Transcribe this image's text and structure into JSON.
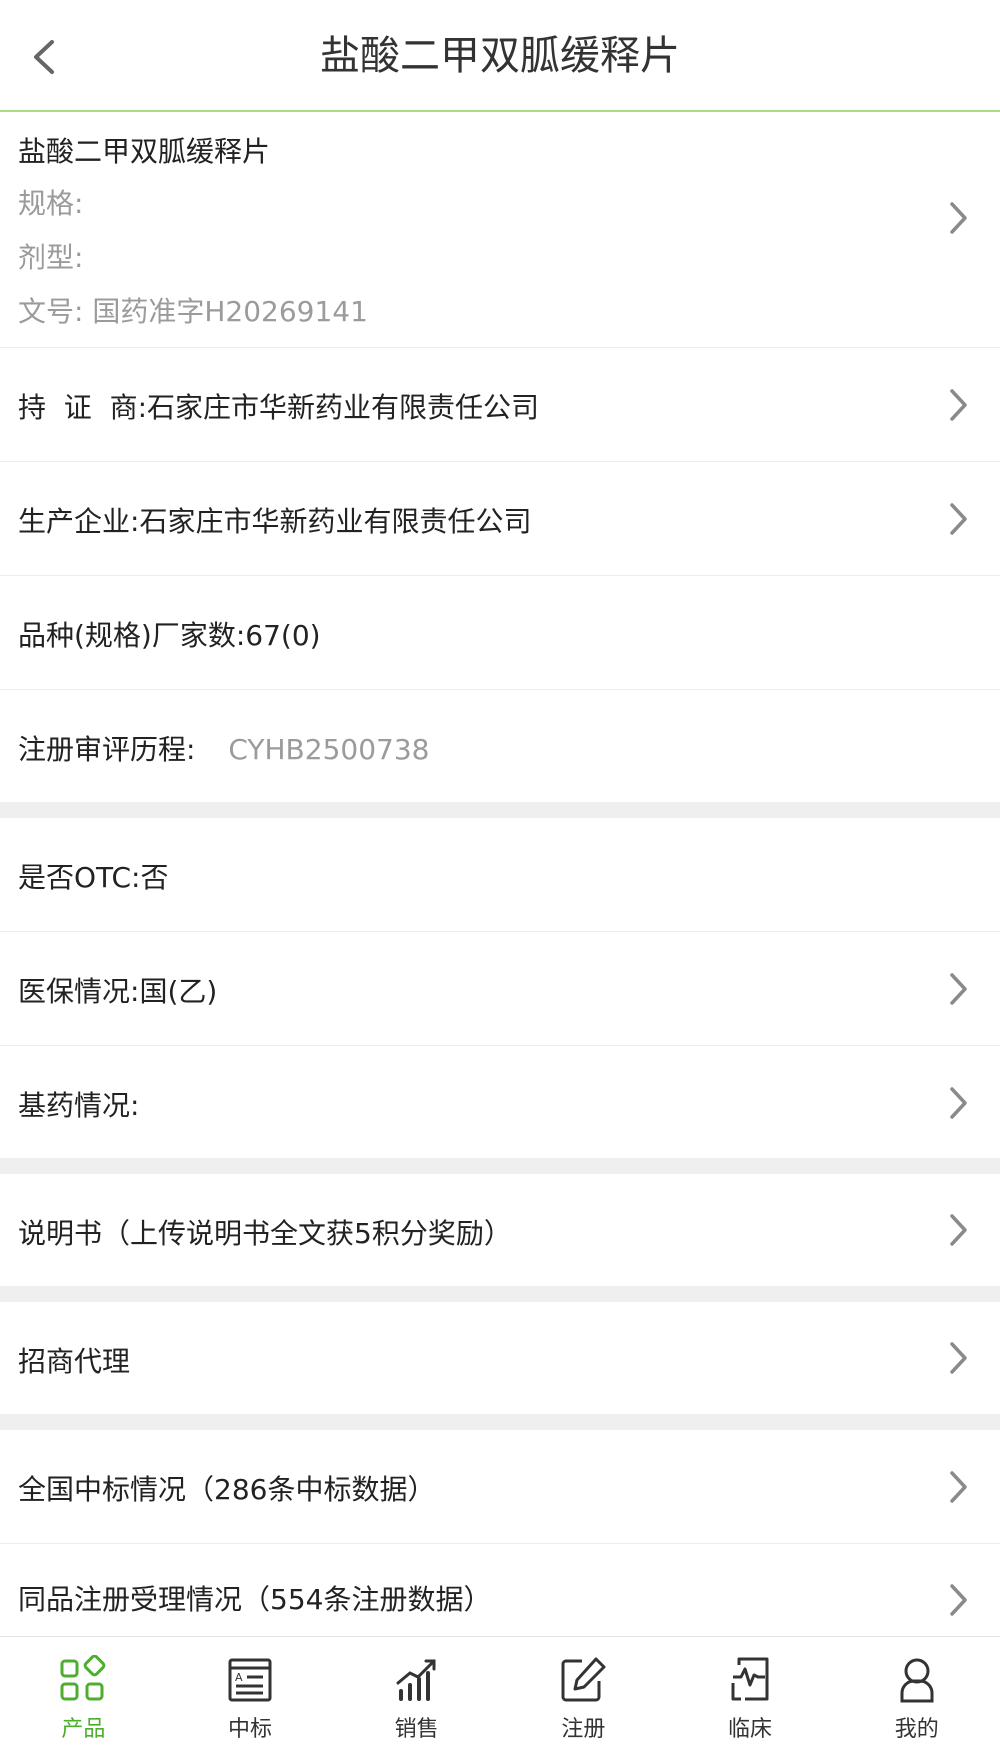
{
  "header": {
    "title": "盐酸二甲双胍缓释片"
  },
  "product": {
    "name": "盐酸二甲双胍缓释片",
    "spec_label": "规格:",
    "form_label": "剂型:",
    "approval_label": "文号:",
    "approval_value": "国药准字H20269141"
  },
  "rows": {
    "holder": {
      "label": "持  证  商:",
      "value": "石家庄市华新药业有限责任公司"
    },
    "manufacturer": {
      "label": "生产企业:",
      "value": "石家庄市华新药业有限责任公司"
    },
    "variety_count": {
      "label": "品种(规格)厂家数:",
      "value": "67(0)"
    },
    "review_history": {
      "label": "注册审评历程:",
      "value": "CYHB2500738"
    },
    "otc": {
      "label": "是否OTC:",
      "value": "否"
    },
    "insurance": {
      "label": "医保情况:",
      "value": "国(乙)"
    },
    "essential": {
      "label": "基药情况:",
      "value": ""
    },
    "manual": {
      "label": "说明书（上传说明书全文获5积分奖励）"
    },
    "agency": {
      "label": "招商代理"
    },
    "bidding": {
      "label": "全国中标情况（286条中标数据）"
    },
    "registration": {
      "label": "同品注册受理情况（554条注册数据）"
    }
  },
  "tabbar": {
    "active_color": "#4cae2c",
    "tabs": [
      {
        "label": "产品",
        "icon": "product-grid-icon",
        "active": true
      },
      {
        "label": "中标",
        "icon": "bid-document-icon",
        "active": false
      },
      {
        "label": "销售",
        "icon": "sales-chart-icon",
        "active": false
      },
      {
        "label": "注册",
        "icon": "edit-note-icon",
        "active": false
      },
      {
        "label": "临床",
        "icon": "clinical-file-icon",
        "active": false
      },
      {
        "label": "我的",
        "icon": "user-icon",
        "active": false
      }
    ]
  }
}
